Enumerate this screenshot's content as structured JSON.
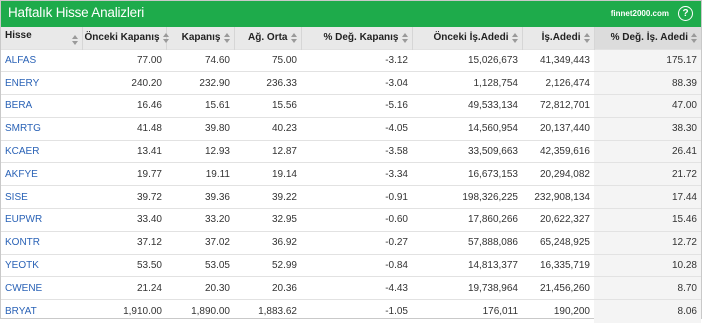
{
  "header": {
    "title": "Haftalık Hisse Analizleri",
    "site": "finnet2000.com",
    "help": "?"
  },
  "columns": [
    "Hisse",
    "Önceki Kapanış",
    "Kapanış",
    "Ağ. Orta",
    "% Değ. Kapanış",
    "Önceki İş.Adedi",
    "İş.Adedi",
    "% Değ. İş. Adedi"
  ],
  "rows": [
    [
      "ALFAS",
      "77.00",
      "74.60",
      "75.00",
      "-3.12",
      "15,026,673",
      "41,349,443",
      "175.17"
    ],
    [
      "ENERY",
      "240.20",
      "232.90",
      "236.33",
      "-3.04",
      "1,128,754",
      "2,126,474",
      "88.39"
    ],
    [
      "BERA",
      "16.46",
      "15.61",
      "15.56",
      "-5.16",
      "49,533,134",
      "72,812,701",
      "47.00"
    ],
    [
      "SMRTG",
      "41.48",
      "39.80",
      "40.23",
      "-4.05",
      "14,560,954",
      "20,137,440",
      "38.30"
    ],
    [
      "KCAER",
      "13.41",
      "12.93",
      "12.87",
      "-3.58",
      "33,509,663",
      "42,359,616",
      "26.41"
    ],
    [
      "AKFYE",
      "19.77",
      "19.11",
      "19.14",
      "-3.34",
      "16,673,153",
      "20,294,082",
      "21.72"
    ],
    [
      "SISE",
      "39.72",
      "39.36",
      "39.22",
      "-0.91",
      "198,326,225",
      "232,908,134",
      "17.44"
    ],
    [
      "EUPWR",
      "33.40",
      "33.20",
      "32.95",
      "-0.60",
      "17,860,266",
      "20,622,327",
      "15.46"
    ],
    [
      "KONTR",
      "37.12",
      "37.02",
      "36.92",
      "-0.27",
      "57,888,086",
      "65,248,925",
      "12.72"
    ],
    [
      "YEOTK",
      "53.50",
      "53.05",
      "52.99",
      "-0.84",
      "14,813,377",
      "16,335,719",
      "10.28"
    ],
    [
      "CWENE",
      "21.24",
      "20.30",
      "20.36",
      "-4.43",
      "19,738,964",
      "21,456,260",
      "8.70"
    ],
    [
      "BRYAT",
      "1,910.00",
      "1,890.00",
      "1,883.62",
      "-1.05",
      "176,011",
      "190,200",
      "8.06"
    ]
  ],
  "colors": {
    "header_bar": "#1eab4b",
    "link": "#2a62b6",
    "column_header_bg": "#e9e9e9"
  }
}
